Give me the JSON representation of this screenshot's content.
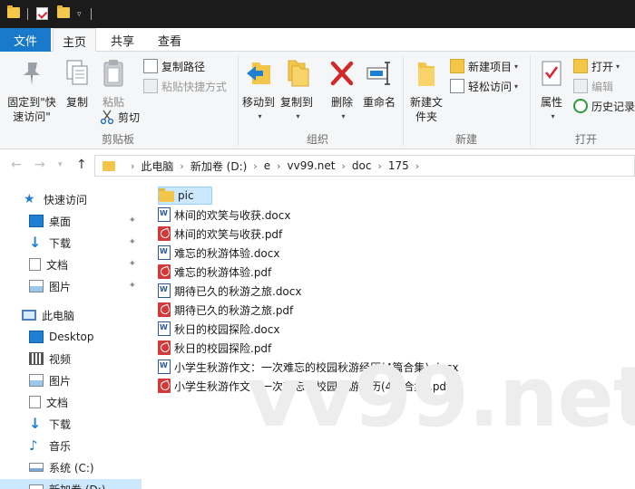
{
  "ribbon_tabs": {
    "file": "文件",
    "home": "主页",
    "share": "共享",
    "view": "查看"
  },
  "clipboard": {
    "pin": "固定到\"快速访问\"",
    "copy": "复制",
    "paste": "粘贴",
    "copy_path": "复制路径",
    "paste_shortcut": "粘贴快捷方式",
    "cut": "剪切",
    "group_label": "剪贴板"
  },
  "organize": {
    "move_to": "移动到",
    "copy_to": "复制到",
    "delete": "删除",
    "rename": "重命名",
    "group_label": "组织"
  },
  "new": {
    "new_folder": "新建文件夹",
    "new_item": "新建项目",
    "easy_access": "轻松访问",
    "group_label": "新建"
  },
  "open": {
    "properties": "属性",
    "open": "打开",
    "edit": "编辑",
    "history": "历史记录",
    "group_label": "打开"
  },
  "breadcrumb": [
    "此电脑",
    "新加卷 (D:)",
    "e",
    "vv99.net",
    "doc",
    "175"
  ],
  "nav": {
    "quick_access": "快速访问",
    "desktop": "桌面",
    "downloads": "下载",
    "documents": "文档",
    "pictures": "图片",
    "this_pc": "此电脑",
    "pc_desktop": "Desktop",
    "pc_videos": "视频",
    "pc_pictures": "图片",
    "pc_documents": "文档",
    "pc_downloads": "下载",
    "pc_music": "音乐",
    "drive_c": "系统 (C:)",
    "drive_d": "新加卷 (D:)"
  },
  "files": [
    {
      "name": "pic",
      "type": "folder"
    },
    {
      "name": "林间的欢笑与收获.docx",
      "type": "docx"
    },
    {
      "name": "林间的欢笑与收获.pdf",
      "type": "pdf"
    },
    {
      "name": "难忘的秋游体验.docx",
      "type": "docx"
    },
    {
      "name": "难忘的秋游体验.pdf",
      "type": "pdf"
    },
    {
      "name": "期待已久的秋游之旅.docx",
      "type": "docx"
    },
    {
      "name": "期待已久的秋游之旅.pdf",
      "type": "pdf"
    },
    {
      "name": "秋日的校园探险.docx",
      "type": "docx"
    },
    {
      "name": "秋日的校园探险.pdf",
      "type": "pdf"
    },
    {
      "name": "小学生秋游作文：一次难忘的校园秋游经历(4篇合集).docx",
      "type": "docx"
    },
    {
      "name": "小学生秋游作文：一次难忘的校园秋游经历(4篇合集).pdf",
      "type": "pdf"
    }
  ],
  "watermark": "vv99.net"
}
